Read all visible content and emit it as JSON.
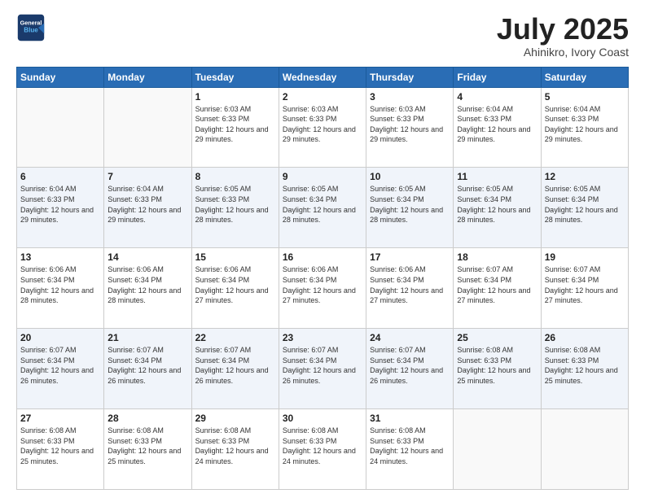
{
  "header": {
    "logo_line1": "General",
    "logo_line2": "Blue",
    "title": "July 2025",
    "subtitle": "Ahinikro, Ivory Coast"
  },
  "weekdays": [
    "Sunday",
    "Monday",
    "Tuesday",
    "Wednesday",
    "Thursday",
    "Friday",
    "Saturday"
  ],
  "weeks": [
    [
      {
        "day": "",
        "info": ""
      },
      {
        "day": "",
        "info": ""
      },
      {
        "day": "1",
        "info": "Sunrise: 6:03 AM\nSunset: 6:33 PM\nDaylight: 12 hours and 29 minutes."
      },
      {
        "day": "2",
        "info": "Sunrise: 6:03 AM\nSunset: 6:33 PM\nDaylight: 12 hours and 29 minutes."
      },
      {
        "day": "3",
        "info": "Sunrise: 6:03 AM\nSunset: 6:33 PM\nDaylight: 12 hours and 29 minutes."
      },
      {
        "day": "4",
        "info": "Sunrise: 6:04 AM\nSunset: 6:33 PM\nDaylight: 12 hours and 29 minutes."
      },
      {
        "day": "5",
        "info": "Sunrise: 6:04 AM\nSunset: 6:33 PM\nDaylight: 12 hours and 29 minutes."
      }
    ],
    [
      {
        "day": "6",
        "info": "Sunrise: 6:04 AM\nSunset: 6:33 PM\nDaylight: 12 hours and 29 minutes."
      },
      {
        "day": "7",
        "info": "Sunrise: 6:04 AM\nSunset: 6:33 PM\nDaylight: 12 hours and 29 minutes."
      },
      {
        "day": "8",
        "info": "Sunrise: 6:05 AM\nSunset: 6:33 PM\nDaylight: 12 hours and 28 minutes."
      },
      {
        "day": "9",
        "info": "Sunrise: 6:05 AM\nSunset: 6:34 PM\nDaylight: 12 hours and 28 minutes."
      },
      {
        "day": "10",
        "info": "Sunrise: 6:05 AM\nSunset: 6:34 PM\nDaylight: 12 hours and 28 minutes."
      },
      {
        "day": "11",
        "info": "Sunrise: 6:05 AM\nSunset: 6:34 PM\nDaylight: 12 hours and 28 minutes."
      },
      {
        "day": "12",
        "info": "Sunrise: 6:05 AM\nSunset: 6:34 PM\nDaylight: 12 hours and 28 minutes."
      }
    ],
    [
      {
        "day": "13",
        "info": "Sunrise: 6:06 AM\nSunset: 6:34 PM\nDaylight: 12 hours and 28 minutes."
      },
      {
        "day": "14",
        "info": "Sunrise: 6:06 AM\nSunset: 6:34 PM\nDaylight: 12 hours and 28 minutes."
      },
      {
        "day": "15",
        "info": "Sunrise: 6:06 AM\nSunset: 6:34 PM\nDaylight: 12 hours and 27 minutes."
      },
      {
        "day": "16",
        "info": "Sunrise: 6:06 AM\nSunset: 6:34 PM\nDaylight: 12 hours and 27 minutes."
      },
      {
        "day": "17",
        "info": "Sunrise: 6:06 AM\nSunset: 6:34 PM\nDaylight: 12 hours and 27 minutes."
      },
      {
        "day": "18",
        "info": "Sunrise: 6:07 AM\nSunset: 6:34 PM\nDaylight: 12 hours and 27 minutes."
      },
      {
        "day": "19",
        "info": "Sunrise: 6:07 AM\nSunset: 6:34 PM\nDaylight: 12 hours and 27 minutes."
      }
    ],
    [
      {
        "day": "20",
        "info": "Sunrise: 6:07 AM\nSunset: 6:34 PM\nDaylight: 12 hours and 26 minutes."
      },
      {
        "day": "21",
        "info": "Sunrise: 6:07 AM\nSunset: 6:34 PM\nDaylight: 12 hours and 26 minutes."
      },
      {
        "day": "22",
        "info": "Sunrise: 6:07 AM\nSunset: 6:34 PM\nDaylight: 12 hours and 26 minutes."
      },
      {
        "day": "23",
        "info": "Sunrise: 6:07 AM\nSunset: 6:34 PM\nDaylight: 12 hours and 26 minutes."
      },
      {
        "day": "24",
        "info": "Sunrise: 6:07 AM\nSunset: 6:34 PM\nDaylight: 12 hours and 26 minutes."
      },
      {
        "day": "25",
        "info": "Sunrise: 6:08 AM\nSunset: 6:33 PM\nDaylight: 12 hours and 25 minutes."
      },
      {
        "day": "26",
        "info": "Sunrise: 6:08 AM\nSunset: 6:33 PM\nDaylight: 12 hours and 25 minutes."
      }
    ],
    [
      {
        "day": "27",
        "info": "Sunrise: 6:08 AM\nSunset: 6:33 PM\nDaylight: 12 hours and 25 minutes."
      },
      {
        "day": "28",
        "info": "Sunrise: 6:08 AM\nSunset: 6:33 PM\nDaylight: 12 hours and 25 minutes."
      },
      {
        "day": "29",
        "info": "Sunrise: 6:08 AM\nSunset: 6:33 PM\nDaylight: 12 hours and 24 minutes."
      },
      {
        "day": "30",
        "info": "Sunrise: 6:08 AM\nSunset: 6:33 PM\nDaylight: 12 hours and 24 minutes."
      },
      {
        "day": "31",
        "info": "Sunrise: 6:08 AM\nSunset: 6:33 PM\nDaylight: 12 hours and 24 minutes."
      },
      {
        "day": "",
        "info": ""
      },
      {
        "day": "",
        "info": ""
      }
    ]
  ]
}
